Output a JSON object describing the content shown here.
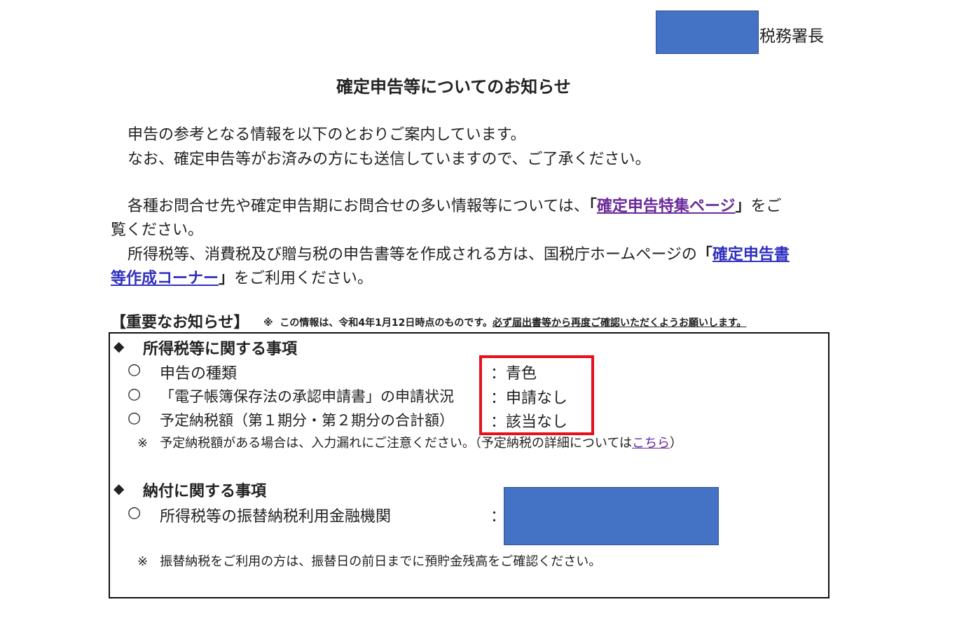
{
  "header": {
    "office_suffix": "税務署長"
  },
  "title": "確定申告等についてのお知らせ",
  "intro": {
    "line1": "申告の参考となる情報を以下のとおりご案内しています。",
    "line2": "なお、確定申告等がお済みの方にも送信していますので、ご了承ください。"
  },
  "para1": {
    "pre": "各種お問合せ先や確定申告期にお問合せの多い情報等については、",
    "bracket_open": "「",
    "link": "確定申告特集ページ",
    "bracket_close": "」",
    "post": "をご",
    "line2": "覧ください。"
  },
  "para2": {
    "pre": "所得税等、消費税及び贈与税の申告書等を作成される方は、国税庁ホームページの",
    "bracket_open": "「",
    "link_part1": "確定申告書",
    "link_part2": "等作成コーナー",
    "bracket_close": "」",
    "post": "をご利用ください。"
  },
  "notice": {
    "heading": "【重要なお知らせ】",
    "mark": "※",
    "note_plain": "この情報は、令和4年1月12日時点のものです。",
    "note_underlined": "必ず届出書等から再度ご確認いただくようお願いします。"
  },
  "section_income": {
    "bullet": "◆",
    "heading": "所得税等に関する事項",
    "items": [
      {
        "circle": "○",
        "label": "申告の種類",
        "value": "：青色"
      },
      {
        "circle": "○",
        "label": "「電子帳簿保存法の承認申請書」の申請状況",
        "value": "：申請なし"
      },
      {
        "circle": "○",
        "label": "予定納税額（第１期分・第２期分の合計額）",
        "value": "：該当なし"
      }
    ],
    "note_mark": "※",
    "note_text": "予定納税額がある場合は、入力漏れにご注意ください。（予定納税の詳細については",
    "note_link": "こちら",
    "note_close": "）"
  },
  "section_payment": {
    "bullet": "◆",
    "heading": "納付に関する事項",
    "item": {
      "circle": "○",
      "label": "所得税等の振替納税利用金融機関",
      "colon": "："
    },
    "note_mark": "※",
    "note_text": "振替納税をご利用の方は、振替日の前日までに預貯金残高をご確認ください。"
  },
  "colors": {
    "redaction": "#4472c4",
    "highlight": "#e8101a",
    "link": "#3030c0",
    "link_visited": "#6a2a9a"
  }
}
